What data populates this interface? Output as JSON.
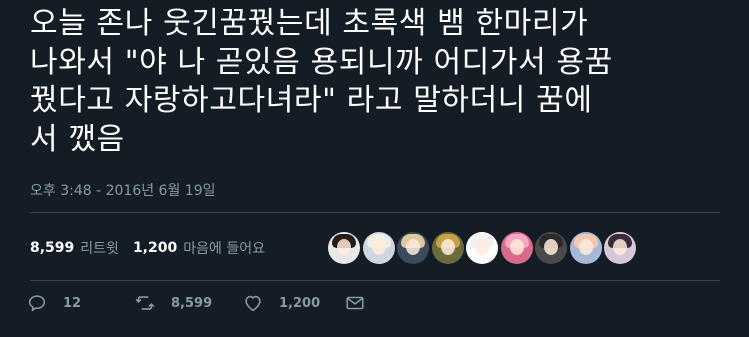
{
  "tweet": {
    "text_lines": [
      "오늘 존나 웃긴꿈꿨는데 초록색 뱀 한마리가",
      "나와서 \"야 나 곧있음 용되니까 어디가서 용꿈",
      "꿨다고 자랑하고다녀라\" 라고 말하더니 꿈에",
      "서 깼음"
    ],
    "timestamp": "오후 3:48 - 2016년 6월 19일"
  },
  "stats": {
    "retweets_count": "8,599",
    "retweets_label": "리트윗",
    "likes_count": "1,200",
    "likes_label": "마음에 들어요"
  },
  "liker_avatars": [
    {
      "bg": "#e8e8e8",
      "hair": "#2a1a14"
    },
    {
      "bg": "#cfd6e0",
      "hair": "#f1efe9"
    },
    {
      "bg": "#3d4a5c",
      "hair": "#e0c8a0"
    },
    {
      "bg": "#6b6a3a",
      "hair": "#c8a24a"
    },
    {
      "bg": "#ffffff",
      "hair": "#f2f2f2"
    },
    {
      "bg": "#d86a8a",
      "hair": "#f0a8c4"
    },
    {
      "bg": "#4a4a4a",
      "hair": "#2a2a2a"
    },
    {
      "bg": "#a7b9d4",
      "hair": "#f4c8b0"
    },
    {
      "bg": "#d8c7d8",
      "hair": "#3a2a3a"
    }
  ],
  "actions": {
    "reply_count": "12",
    "retweet_count": "8,599",
    "like_count": "1,200",
    "icons": [
      "reply-icon",
      "retweet-icon",
      "like-icon",
      "direct-message-icon"
    ]
  },
  "colors": {
    "background": "#141d26",
    "text": "#ffffff",
    "muted": "#8899a6",
    "divider": "#38444d"
  }
}
